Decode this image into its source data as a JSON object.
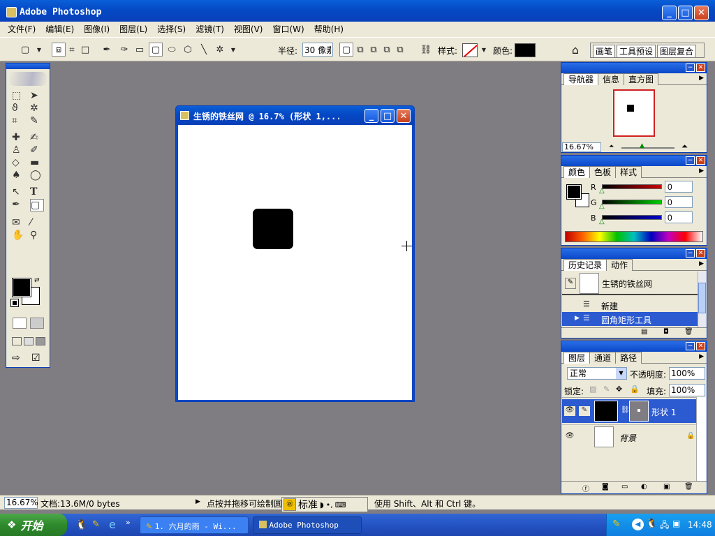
{
  "app": {
    "title": "Adobe Photoshop"
  },
  "menu": [
    "文件(F)",
    "编辑(E)",
    "图像(I)",
    "图层(L)",
    "选择(S)",
    "滤镜(T)",
    "视图(V)",
    "窗口(W)",
    "帮助(H)"
  ],
  "options": {
    "radius_label": "半径:",
    "radius_value": "30 像素",
    "style_label": "样式:",
    "color_label": "颜色:",
    "palette_tabs": [
      "画笔",
      "工具预设",
      "图层复合"
    ]
  },
  "document": {
    "title": "生锈的铁丝网 @ 16.7% (形状 1,..."
  },
  "navigator": {
    "tabs": [
      "导航器",
      "信息",
      "直方图"
    ],
    "zoom": "16.67%"
  },
  "color_panel": {
    "tabs": [
      "颜色",
      "色板",
      "样式"
    ],
    "channels": [
      {
        "label": "R",
        "value": "0",
        "color": "#cc0000"
      },
      {
        "label": "G",
        "value": "0",
        "color": "#00aa00"
      },
      {
        "label": "B",
        "value": "0",
        "color": "#0000cc"
      }
    ]
  },
  "history": {
    "tabs": [
      "历史记录",
      "动作"
    ],
    "snapshot": "生锈的铁丝网",
    "items": [
      "新建",
      "圆角矩形工具"
    ]
  },
  "layers": {
    "tabs": [
      "图层",
      "通道",
      "路径"
    ],
    "blend_mode": "正常",
    "opacity_label": "不透明度:",
    "opacity_value": "100%",
    "lock_label": "锁定:",
    "fill_label": "填充:",
    "fill_value": "100%",
    "items": [
      {
        "name": "形状 1"
      },
      {
        "name": "背景"
      }
    ]
  },
  "status": {
    "zoom": "16.67%",
    "doc_info": "文档:13.6M/0 bytes",
    "hint_prefix": "点按并拖移可绘制圆",
    "hint_suffix": "使用 Shift、Alt 和 Ctrl 键。"
  },
  "ime": {
    "mode": "标准"
  },
  "taskbar": {
    "start": "开始",
    "tasks": [
      "1. 六月的雨 - Wi...",
      "Adobe Photoshop"
    ],
    "clock": "14:48"
  },
  "colors": {
    "accent": "#0a48c8",
    "canvas_bg": "#7f7d82",
    "shape": "#000000"
  }
}
